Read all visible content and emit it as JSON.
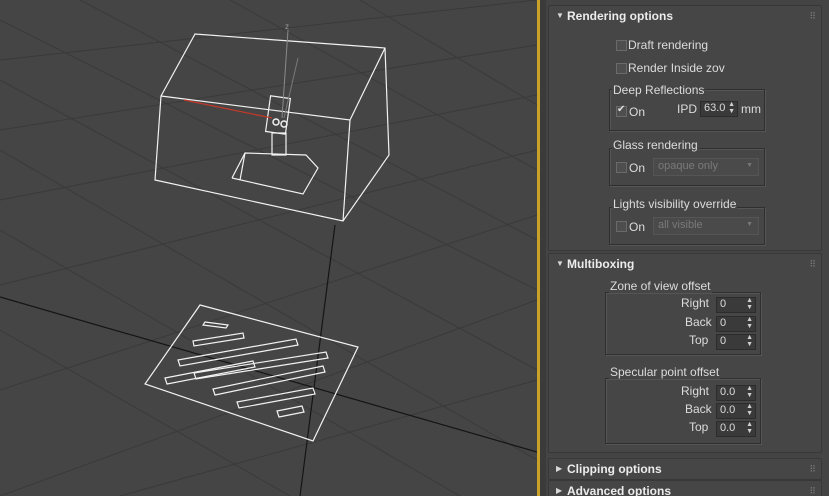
{
  "viewport": {
    "axis_label": "z"
  },
  "panel": {
    "rendering_options": {
      "title": "Rendering options",
      "draft_rendering": {
        "label": "Draft rendering",
        "checked": false
      },
      "render_inside_zov": {
        "label": "Render Inside zov",
        "checked": false
      },
      "deep_reflections": {
        "title": "Deep Reflections",
        "on_label": "On",
        "on_checked": true,
        "ipd_label": "IPD",
        "ipd_value": "63.0",
        "ipd_unit": "mm"
      },
      "glass_rendering": {
        "title": "Glass rendering",
        "on_label": "On",
        "on_checked": false,
        "mode": "opaque only"
      },
      "lights_visibility": {
        "title": "Lights visibility override",
        "on_label": "On",
        "on_checked": false,
        "mode": "all visible"
      }
    },
    "multiboxing": {
      "title": "Multiboxing",
      "zov_offset": {
        "title": "Zone of view offset",
        "right_label": "Right",
        "right_value": "0",
        "back_label": "Back",
        "back_value": "0",
        "top_label": "Top",
        "top_value": "0"
      },
      "specular_offset": {
        "title": "Specular point offset",
        "right_label": "Right",
        "right_value": "0.0",
        "back_label": "Back",
        "back_value": "0.0",
        "top_label": "Top",
        "top_value": "0.0"
      }
    },
    "clipping_options": {
      "title": "Clipping options"
    },
    "advanced_options": {
      "title": "Advanced options"
    }
  }
}
